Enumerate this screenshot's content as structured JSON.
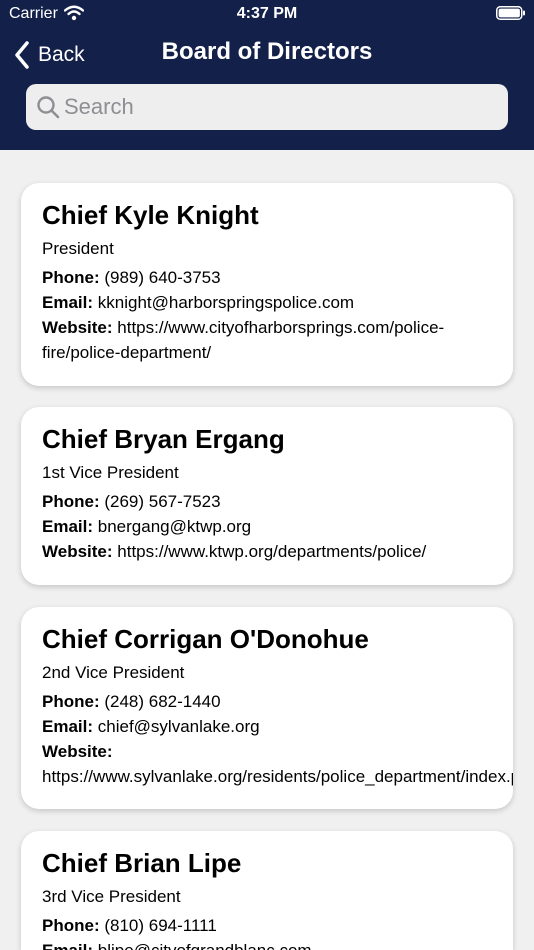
{
  "status": {
    "carrier": "Carrier",
    "time": "4:37 PM"
  },
  "nav": {
    "back_label": "Back",
    "title": "Board of Directors"
  },
  "search": {
    "placeholder": "Search"
  },
  "labels": {
    "phone": "Phone:",
    "email": "Email:",
    "website": "Website:"
  },
  "directors": [
    {
      "name": "Chief Kyle Knight",
      "title": "President",
      "phone": "(989) 640-3753",
      "email": "kknight@harborspringspolice.com",
      "website": "https://www.cityofharborsprings.com/police-fire/police-department/"
    },
    {
      "name": "Chief Bryan Ergang",
      "title": "1st Vice President",
      "phone": "(269) 567-7523",
      "email": "bnergang@ktwp.org",
      "website": "https://www.ktwp.org/departments/police/"
    },
    {
      "name": "Chief Corrigan O'Donohue",
      "title": "2nd Vice President",
      "phone": "(248) 682-1440",
      "email": "chief@sylvanlake.org",
      "website": "https://www.sylvanlake.org/residents/police_department/index.php"
    },
    {
      "name": "Chief Brian Lipe",
      "title": "3rd Vice President",
      "phone": "(810) 694-1111",
      "email": "blipe@cityofgrandblanc.com",
      "website": ""
    }
  ],
  "colors": {
    "nav_background": "#13214a",
    "page_background": "#f0f0f0",
    "card_background": "#ffffff"
  },
  "icons": {
    "back": "chevron-left-icon",
    "search": "search-icon",
    "wifi": "wifi-icon",
    "battery": "battery-icon"
  }
}
